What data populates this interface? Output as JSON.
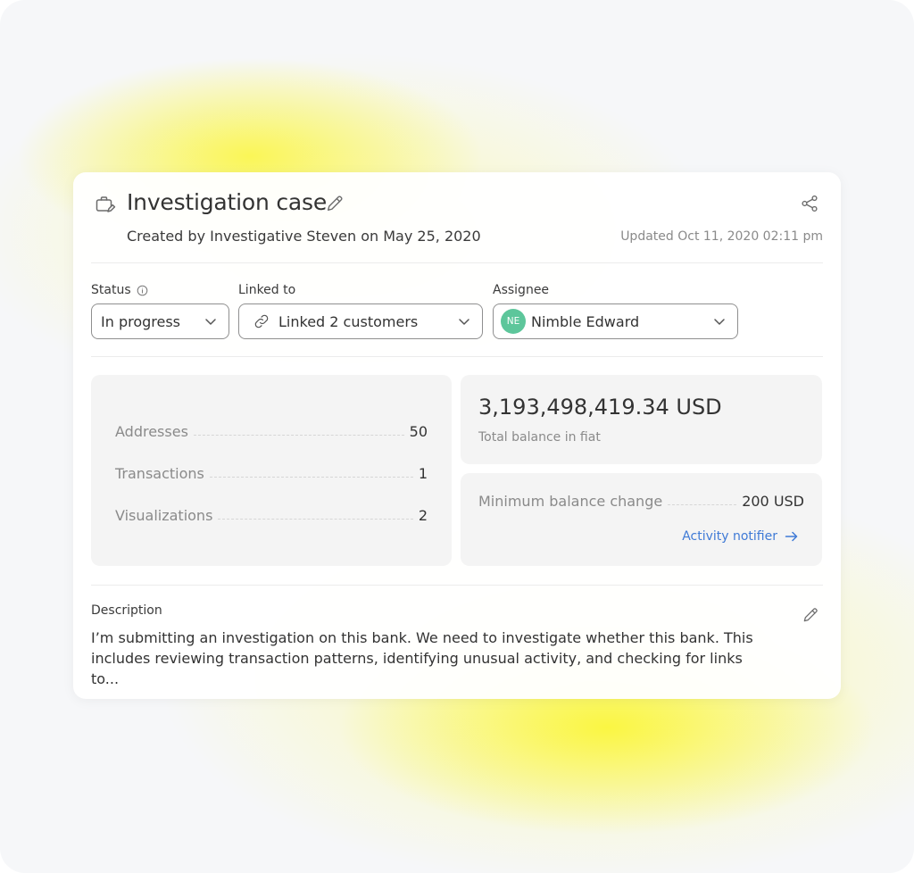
{
  "case": {
    "title": "Investigation case",
    "created": "Created by Investigative Steven on May 25, 2020",
    "updated": "Updated Oct 11, 2020 02:11 pm"
  },
  "fields": {
    "status": {
      "label": "Status",
      "value": "In progress"
    },
    "linked_to": {
      "label": "Linked to",
      "value": "Linked 2 customers"
    },
    "assignee": {
      "label": "Assignee",
      "initials": "NE",
      "value": "Nimble Edward"
    }
  },
  "stats": [
    {
      "label": "Addresses",
      "value": "50"
    },
    {
      "label": "Transactions",
      "value": "1"
    },
    {
      "label": "Visualizations",
      "value": "2"
    }
  ],
  "balance": {
    "amount": "3,193,498,419.34 USD",
    "caption": "Total balance in fiat"
  },
  "min_change": {
    "label": "Minimum balance change",
    "value": "200 USD",
    "link": "Activity notifier"
  },
  "description": {
    "label": "Description",
    "text": "I’m submitting an investigation on this bank. We need to investigate whether this bank. This includes reviewing transaction patterns, identifying unusual activity, and checking for links to..."
  },
  "colors": {
    "accent_link": "#3f7ad6",
    "avatar": "#5dc69b",
    "highlight_glow": "#faf650"
  },
  "icons": [
    "briefcase-edit-icon",
    "pencil-icon",
    "share-icon",
    "info-icon",
    "chevron-down-icon",
    "link-icon",
    "arrow-right-icon"
  ]
}
